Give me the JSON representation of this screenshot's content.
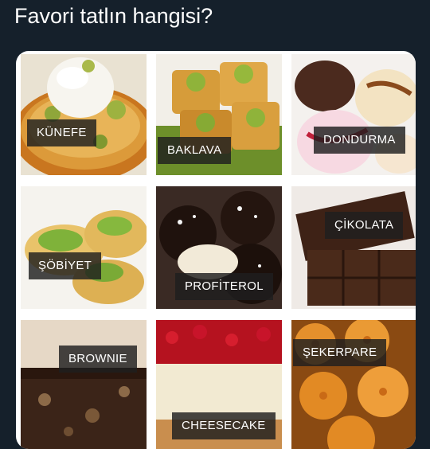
{
  "post": {
    "title": "Favori tatlın hangisi?"
  },
  "desserts": [
    {
      "label": "KÜNEFE"
    },
    {
      "label": "BAKLAVA"
    },
    {
      "label": "DONDURMA"
    },
    {
      "label": "ŞÖBİYET"
    },
    {
      "label": "PROFİTEROL"
    },
    {
      "label": "ÇİKOLATA"
    },
    {
      "label": "BROWNIE"
    },
    {
      "label": "CHEESECAKE"
    },
    {
      "label": "ŞEKERPARE"
    }
  ],
  "colors": {
    "background": "#15202b",
    "title_text": "#ffffff",
    "label_bg": "#1e1e1e"
  }
}
